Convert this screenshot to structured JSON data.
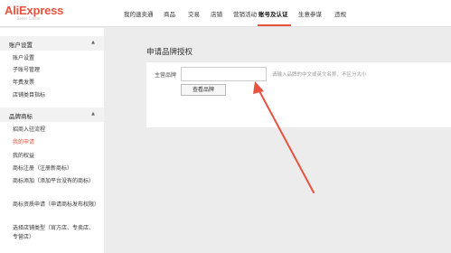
{
  "logo": {
    "brand": "AliExpress",
    "sub": "Seller Center"
  },
  "nav": {
    "items": [
      "我的速卖通",
      "商品",
      "交易",
      "店铺",
      "营销活动",
      "账号及认证",
      "生意参谋",
      "违规"
    ],
    "active_index": 5
  },
  "sidebar": {
    "sections": [
      {
        "title": "账户设置",
        "caret": "▲",
        "items": [
          "账户设置",
          "子账号管理",
          "年费发票",
          "店铺类目指标"
        ]
      },
      {
        "title": "品牌商标",
        "caret": "▲",
        "items": [
          "招商入驻流程",
          "我的申请",
          "我的权益",
          "商标注册（注册新商标）",
          "商标添加（添加平台没有的商标）",
          "商标资质申请（申请商标发布权限）",
          "选择店铺类型（官方店、专卖店、专营店）"
        ]
      }
    ],
    "active_item": "我的申请"
  },
  "main": {
    "title": "申请品牌授权",
    "form": {
      "label": "主营品牌",
      "input_value": "",
      "input_placeholder": "",
      "hint": "请输入品牌的中文或英文名称，不区分大小",
      "button": "查看品牌"
    }
  },
  "colors": {
    "accent": "#e8533f",
    "arrow": "#e8533f"
  }
}
